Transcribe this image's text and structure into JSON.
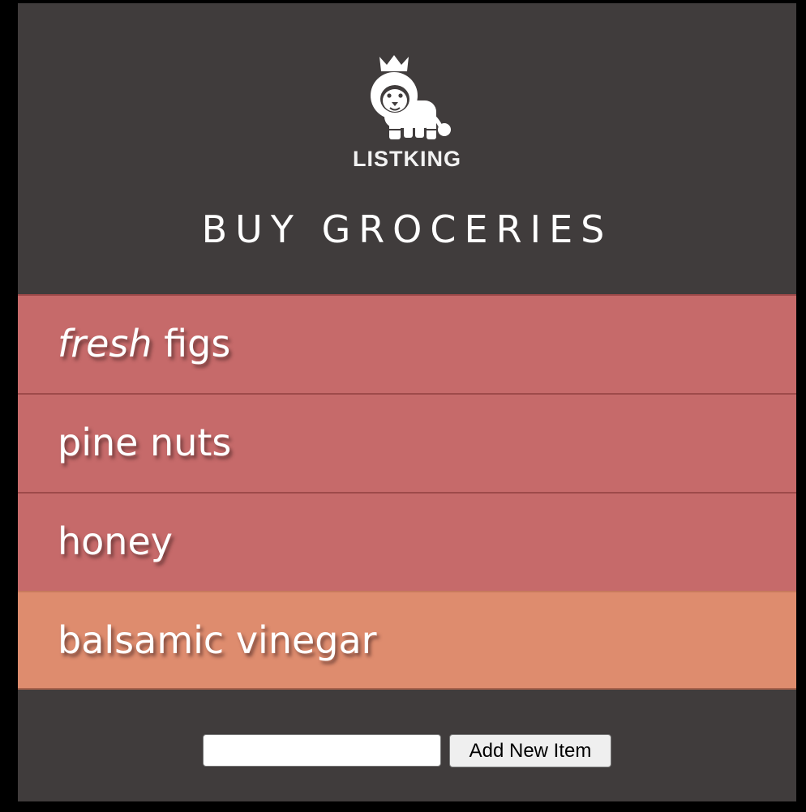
{
  "brand": {
    "name": "LISTKING",
    "logo_icon": "crowned-lion-icon"
  },
  "list": {
    "title": "BUY GROCERIES",
    "items": [
      {
        "emphasis": "fresh",
        "rest": " figs"
      },
      {
        "emphasis": "",
        "rest": "pine nuts"
      },
      {
        "emphasis": "",
        "rest": "honey"
      },
      {
        "emphasis": "",
        "rest": "balsamic vinegar"
      }
    ],
    "highlighted_index": 3
  },
  "form": {
    "input_value": "",
    "add_label": "Add New Item"
  },
  "colors": {
    "background": "#403c3c",
    "item": "#c66a6a",
    "item_highlight": "#de8c6e",
    "text": "#ffffff"
  }
}
